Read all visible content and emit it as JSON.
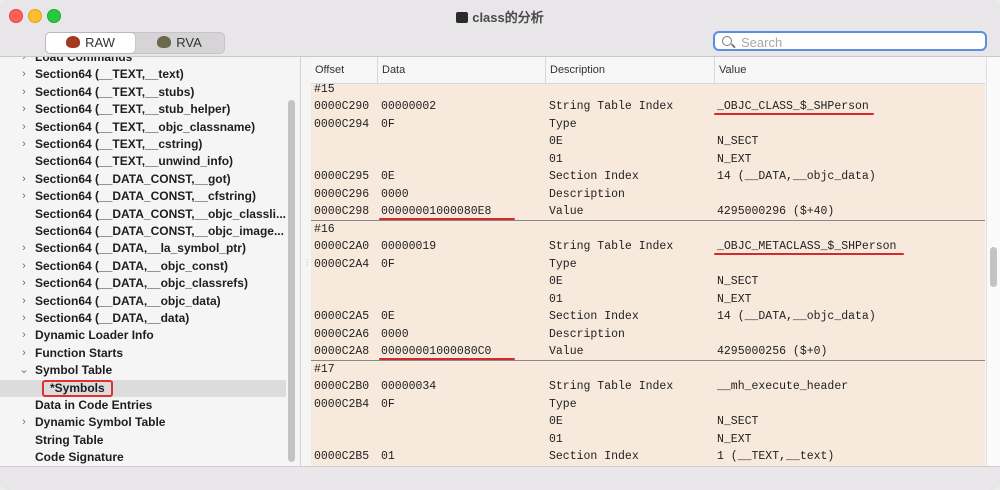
{
  "window": {
    "title": "class的分析"
  },
  "toolbar": {
    "raw_label": "RAW",
    "rva_label": "RVA",
    "search_placeholder": "Search"
  },
  "sidebar": {
    "items": [
      {
        "label": "Load Commands",
        "chevron": "›"
      },
      {
        "label": "Section64 (__TEXT,__text)",
        "chevron": "›"
      },
      {
        "label": "Section64 (__TEXT,__stubs)",
        "chevron": "›"
      },
      {
        "label": "Section64 (__TEXT,__stub_helper)",
        "chevron": "›"
      },
      {
        "label": "Section64 (__TEXT,__objc_classname)",
        "chevron": "›"
      },
      {
        "label": "Section64 (__TEXT,__cstring)",
        "chevron": "›"
      },
      {
        "label": "Section64 (__TEXT,__unwind_info)",
        "chevron": ""
      },
      {
        "label": "Section64 (__DATA_CONST,__got)",
        "chevron": "›"
      },
      {
        "label": "Section64 (__DATA_CONST,__cfstring)",
        "chevron": "›"
      },
      {
        "label": "Section64 (__DATA_CONST,__objc_classli...",
        "chevron": ""
      },
      {
        "label": "Section64 (__DATA_CONST,__objc_image...",
        "chevron": ""
      },
      {
        "label": "Section64 (__DATA,__la_symbol_ptr)",
        "chevron": "›"
      },
      {
        "label": "Section64 (__DATA,__objc_const)",
        "chevron": "›"
      },
      {
        "label": "Section64 (__DATA,__objc_classrefs)",
        "chevron": "›"
      },
      {
        "label": "Section64 (__DATA,__objc_data)",
        "chevron": "›"
      },
      {
        "label": "Section64 (__DATA,__data)",
        "chevron": "›"
      },
      {
        "label": "Dynamic Loader Info",
        "chevron": "›"
      },
      {
        "label": "Function Starts",
        "chevron": "›"
      },
      {
        "label": "Symbol Table",
        "chevron": "⌄"
      },
      {
        "label": "*Symbols",
        "chevron": "",
        "selected": true
      },
      {
        "label": "Data in Code Entries",
        "chevron": ""
      },
      {
        "label": "Dynamic Symbol Table",
        "chevron": "›"
      },
      {
        "label": "String Table",
        "chevron": ""
      },
      {
        "label": "Code Signature",
        "chevron": ""
      }
    ]
  },
  "table": {
    "headers": [
      "Offset",
      "Data",
      "Description",
      "Value"
    ],
    "rows": [
      [
        "#15",
        "",
        "",
        ""
      ],
      [
        "0000C290",
        "00000002",
        "String Table Index",
        "_OBJC_CLASS_$_SHPerson"
      ],
      [
        "0000C294",
        "0F",
        "Type",
        ""
      ],
      [
        "",
        "",
        "0E",
        "N_SECT"
      ],
      [
        "",
        "",
        "01",
        "N_EXT"
      ],
      [
        "0000C295",
        "0E",
        "Section Index",
        "14 (__DATA,__objc_data)"
      ],
      [
        "0000C296",
        "0000",
        "Description",
        ""
      ],
      [
        "0000C298",
        "00000001000080E8",
        "Value",
        "4295000296 ($+40)"
      ],
      [
        "#16",
        "",
        "",
        ""
      ],
      [
        "0000C2A0",
        "00000019",
        "String Table Index",
        "_OBJC_METACLASS_$_SHPerson"
      ],
      [
        "0000C2A4",
        "0F",
        "Type",
        ""
      ],
      [
        "",
        "",
        "0E",
        "N_SECT"
      ],
      [
        "",
        "",
        "01",
        "N_EXT"
      ],
      [
        "0000C2A5",
        "0E",
        "Section Index",
        "14 (__DATA,__objc_data)"
      ],
      [
        "0000C2A6",
        "0000",
        "Description",
        ""
      ],
      [
        "0000C2A8",
        "00000001000080C0",
        "Value",
        "4295000256 ($+0)"
      ],
      [
        "#17",
        "",
        "",
        ""
      ],
      [
        "0000C2B0",
        "00000034",
        "String Table Index",
        "__mh_execute_header"
      ],
      [
        "0000C2B4",
        "0F",
        "Type",
        ""
      ],
      [
        "",
        "",
        "0E",
        "N_SECT"
      ],
      [
        "",
        "",
        "01",
        "N_EXT"
      ],
      [
        "0000C2B5",
        "01",
        "Section Index",
        "1 (__TEXT,__text)"
      ]
    ]
  },
  "colors": {
    "row_bg": "#f8e9dd",
    "highlight": "#d42a2a",
    "search_focus": "#5a8fe0"
  }
}
